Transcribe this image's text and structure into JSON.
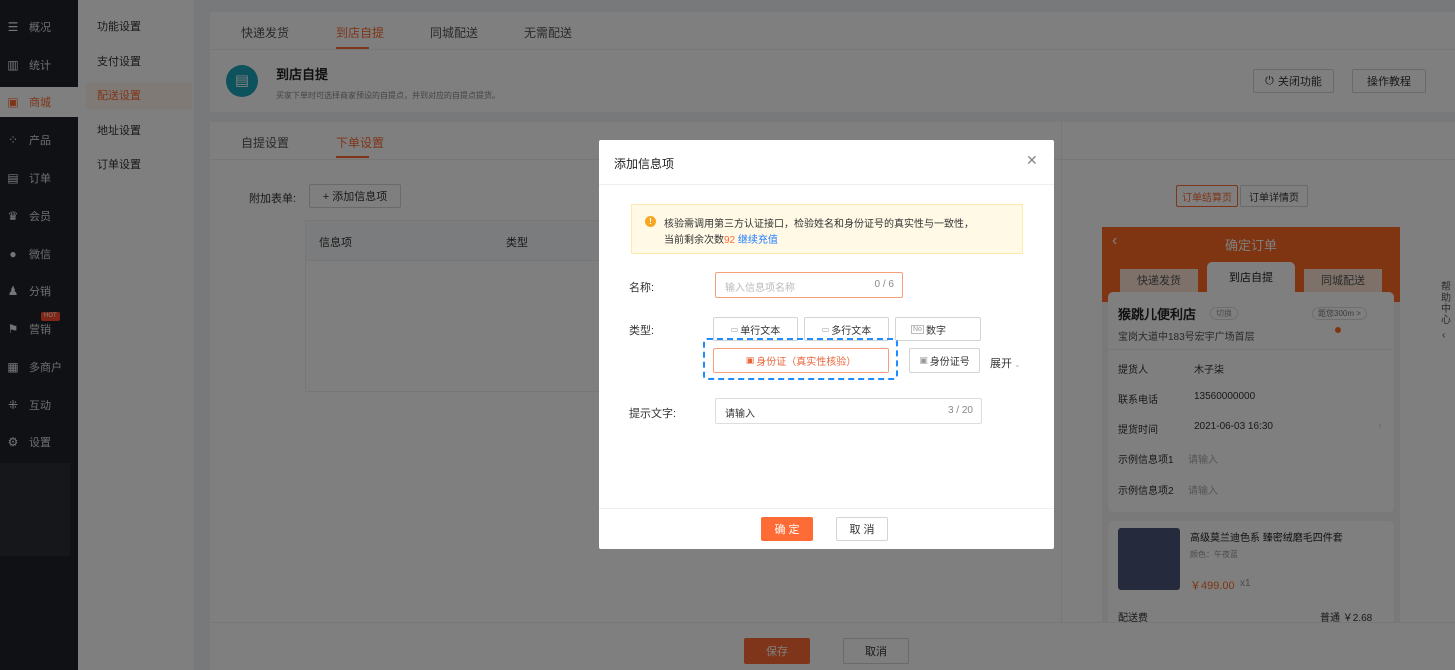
{
  "nav": {
    "items": [
      {
        "label": "概况",
        "icon": "dashboard-icon"
      },
      {
        "label": "统计",
        "icon": "stats-icon"
      },
      {
        "label": "商城",
        "icon": "shop-icon"
      },
      {
        "label": "产品",
        "icon": "product-icon"
      },
      {
        "label": "订单",
        "icon": "order-icon"
      },
      {
        "label": "会员",
        "icon": "member-crown-icon"
      },
      {
        "label": "微信",
        "icon": "wechat-icon"
      },
      {
        "label": "分销",
        "icon": "distribution-icon"
      },
      {
        "label": "营销",
        "icon": "marketing-flag-icon",
        "badge": "HOT"
      },
      {
        "label": "多商户",
        "icon": "multi-merchant-icon"
      },
      {
        "label": "互动",
        "icon": "interaction-icon"
      },
      {
        "label": "设置",
        "icon": "gear-icon"
      }
    ]
  },
  "subnav": {
    "items": [
      "功能设置",
      "支付设置",
      "配送设置",
      "地址设置",
      "订单设置"
    ]
  },
  "delivery_tabs": [
    "快递发货",
    "到店自提",
    "同城配送",
    "无需配送"
  ],
  "header": {
    "title": "到店自提",
    "desc": "买家下单时可选择商家预设的自提点，并到对应的自提点提货。",
    "close_btn": "关闭功能",
    "tutorial_btn": "操作教程"
  },
  "settings_tabs": [
    "自提设置",
    "下单设置"
  ],
  "form": {
    "label": "附加表单:",
    "add_btn": "+ 添加信息项",
    "col_item": "信息项",
    "col_type": "类型"
  },
  "preview": {
    "tabs": [
      "订单结算页",
      "订单详情页"
    ],
    "title": "确定订单",
    "delivery_tabs": [
      "快递发货",
      "到店自提",
      "同城配送"
    ],
    "store": "猴跳儿便利店",
    "switch": "切换",
    "distance": "距您300m >",
    "address": "宝岗大道中183号宏宇广场首层",
    "rows": [
      {
        "k": "提货人",
        "v": "木子柒"
      },
      {
        "k": "联系电话",
        "v": "13560000000"
      },
      {
        "k": "提货时间",
        "v": "2021-06-03 16:30"
      },
      {
        "k": "示例信息项1",
        "v": "请输入"
      },
      {
        "k": "示例信息项2",
        "v": "请输入"
      }
    ],
    "product": "高级莫兰迪色系 臻密绒磨毛四件套",
    "color": "颜色：午夜蓝",
    "price": "￥499.00",
    "qty": "x1",
    "ship_label": "配送费",
    "ship_value": "普通 ￥2.68"
  },
  "help": "帮助中心",
  "footer": {
    "save": "保存",
    "cancel": "取消"
  },
  "modal": {
    "title": "添加信息项",
    "notice_line1": "核验需调用第三方认证接口，检验姓名和身份证号的真实性与一致性，",
    "notice_prefix": "当前剩余次数",
    "notice_count": "92",
    "notice_link": "继续充值",
    "name_label": "名称:",
    "name_placeholder": "输入信息项名称",
    "name_count": "0 / 6",
    "type_label": "类型:",
    "types": [
      "单行文本",
      "多行文本",
      "数字",
      "身份证（真实性核验）",
      "身份证号"
    ],
    "expand": "展开",
    "hint_label": "提示文字:",
    "hint_value": "请输入",
    "hint_count": "3 / 20",
    "ok": "确 定",
    "cancel": "取 消"
  },
  "colors": {
    "accent": "#ff6b35",
    "nav_bg": "#1f2329",
    "highlight": "#1f8cff",
    "notice_bg": "#fff9e6"
  }
}
